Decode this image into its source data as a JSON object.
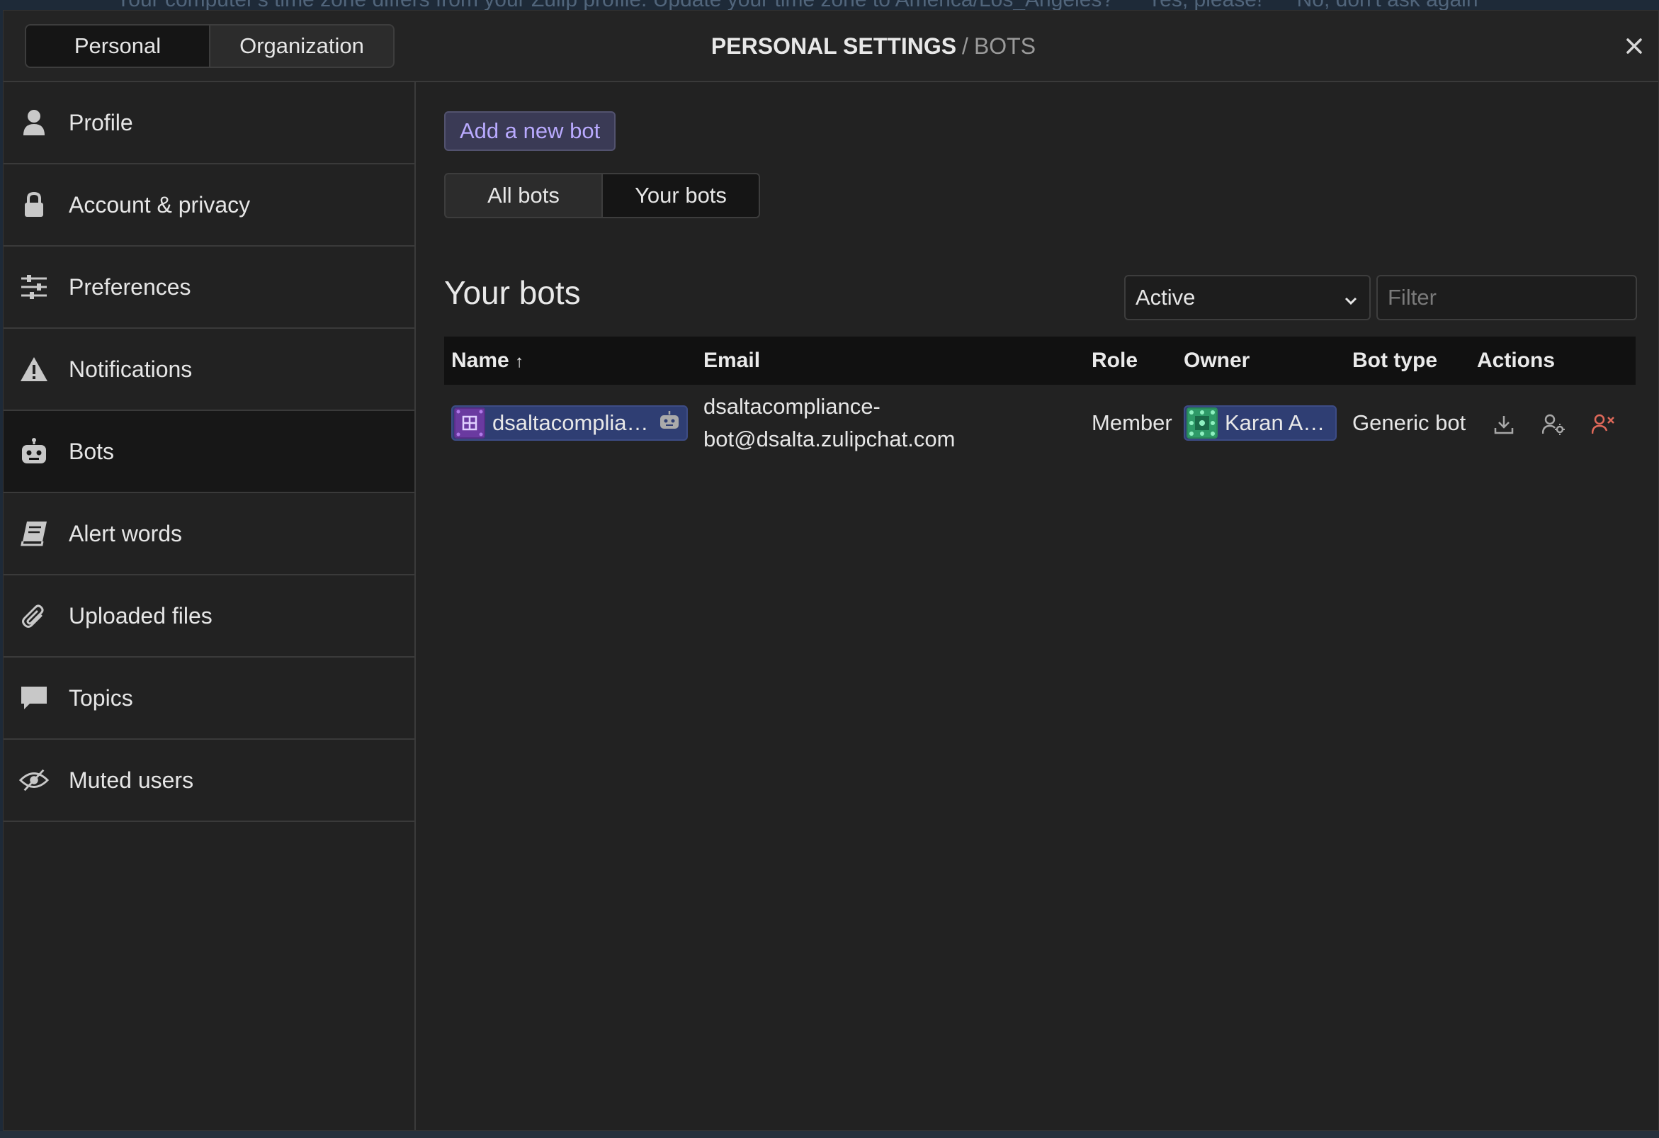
{
  "background": {
    "banner_text": "Your computer's time zone differs from your Zulip profile. Update your time zone to America/Los_Angeles?",
    "banner_yes": "Yes, please!",
    "banner_no": "No, don't ask again"
  },
  "header": {
    "toggle": {
      "personal": "Personal",
      "organization": "Organization",
      "selected": "Personal"
    },
    "title": "PERSONAL SETTINGS",
    "separator": "/",
    "subtitle": "BOTS"
  },
  "sidebar": {
    "items": [
      {
        "label": "Profile",
        "icon": "user-icon"
      },
      {
        "label": "Account & privacy",
        "icon": "lock-icon"
      },
      {
        "label": "Preferences",
        "icon": "sliders-icon"
      },
      {
        "label": "Notifications",
        "icon": "warning-icon"
      },
      {
        "label": "Bots",
        "icon": "robot-icon",
        "active": true
      },
      {
        "label": "Alert words",
        "icon": "book-icon"
      },
      {
        "label": "Uploaded files",
        "icon": "paperclip-icon"
      },
      {
        "label": "Topics",
        "icon": "chat-bubble-icon"
      },
      {
        "label": "Muted users",
        "icon": "eye-slash-icon"
      }
    ]
  },
  "main": {
    "add_bot": "Add a new bot",
    "tabs": {
      "all": "All bots",
      "yours": "Your bots",
      "selected": "Your bots"
    },
    "section_title": "Your bots",
    "status_select": "Active",
    "filter_placeholder": "Filter",
    "table": {
      "headers": {
        "name": "Name",
        "sort_arrow": "↑",
        "email": "Email",
        "role": "Role",
        "owner": "Owner",
        "bot_type": "Bot type",
        "actions": "Actions"
      },
      "rows": [
        {
          "name": "dsaltacomplia…",
          "email_line1": "dsaltacompliance-",
          "email_line2": "bot@dsalta.zulipchat.com",
          "role": "Member",
          "owner": "Karan A…",
          "bot_type": "Generic bot"
        }
      ]
    }
  },
  "colors": {
    "accent": "#b9aaff",
    "pill": "#2f3e73",
    "danger": "#e0695a"
  }
}
